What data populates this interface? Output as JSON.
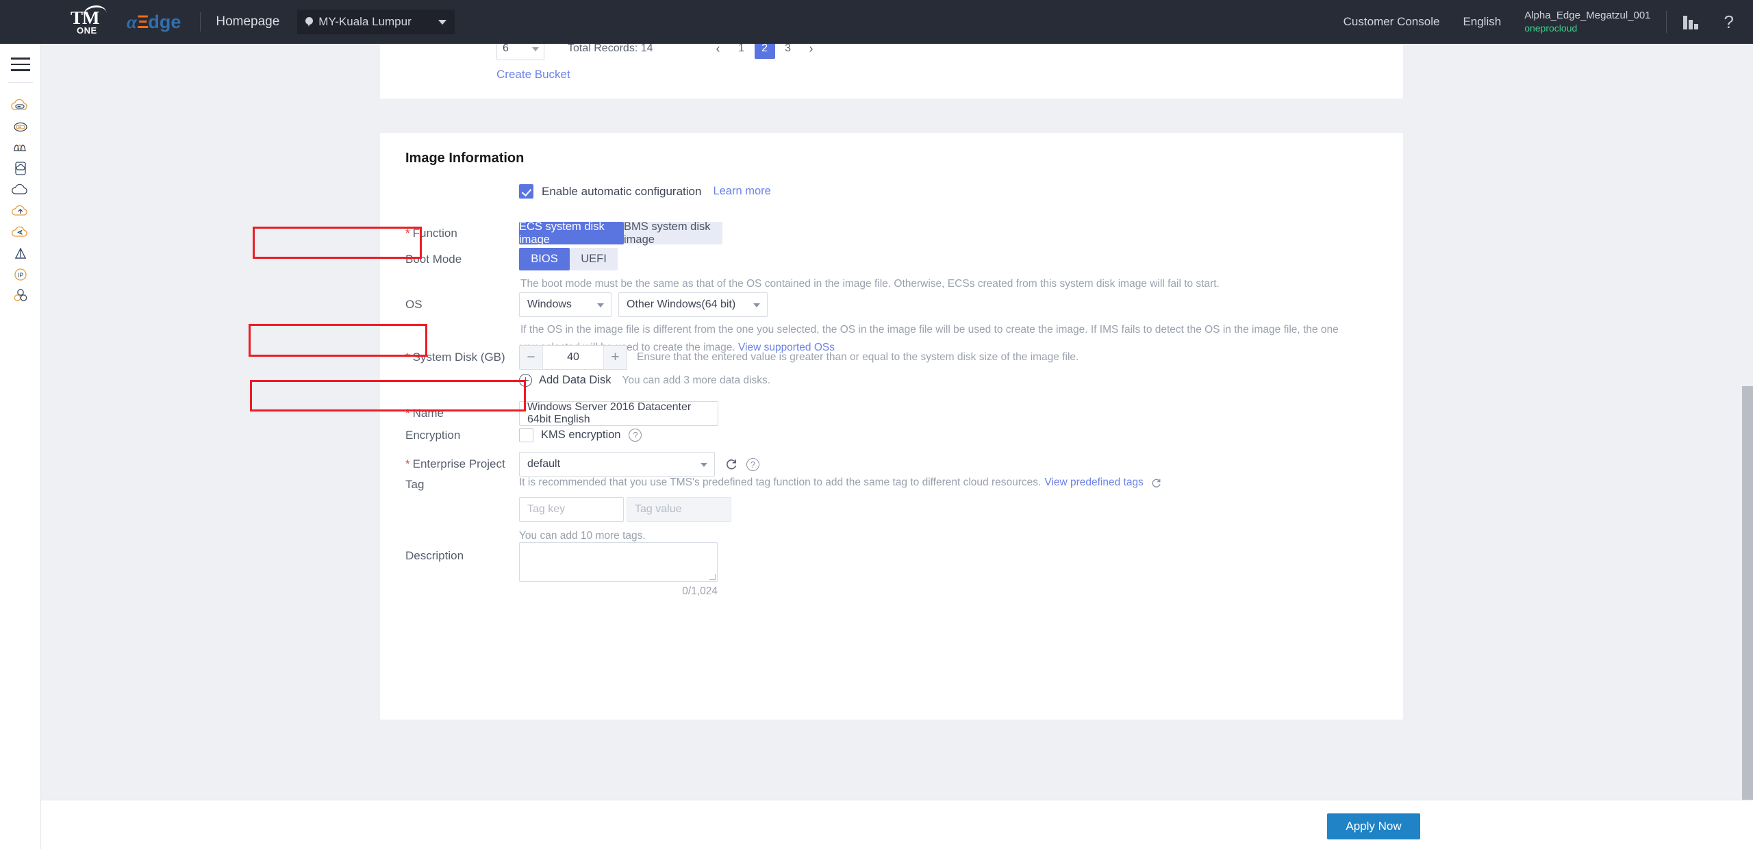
{
  "topnav": {
    "logo_tm": "TM",
    "logo_one": "ONE",
    "logo_alpha_a": "α",
    "logo_alpha_e": "Ξ",
    "logo_alpha_dge": "dge",
    "homepage": "Homepage",
    "region": "MY-Kuala Lumpur",
    "customer_console": "Customer Console",
    "language": "English",
    "account_name": "Alpha_Edge_Megatzul_001",
    "account_sub": "oneprocloud",
    "chart_icon": "bar-chart-icon",
    "help_icon": "question-mark-icon"
  },
  "rail": {
    "menu_icon": "hamburger-menu-icon",
    "items": [
      {
        "icon": "cloud-server-icon"
      },
      {
        "icon": "cloud-storage-icon"
      },
      {
        "icon": "network-wave-icon"
      },
      {
        "icon": "device-cloud-icon"
      },
      {
        "icon": "cloud-icon"
      },
      {
        "icon": "cloud-upload-icon"
      },
      {
        "icon": "cloud-migrate-icon"
      },
      {
        "icon": "antenna-icon"
      },
      {
        "icon": "ip-icon"
      },
      {
        "icon": "cluster-icon"
      }
    ]
  },
  "pager": {
    "page_size": "6",
    "total_records": "Total Records: 14",
    "prev": "‹",
    "next": "›",
    "pages": [
      "1",
      "2",
      "3"
    ],
    "active_page": "2"
  },
  "create_bucket": "Create Bucket",
  "form": {
    "section_title": "Image Information",
    "auto_config": {
      "label": "Enable automatic configuration",
      "learn_more": "Learn more",
      "checked": true
    },
    "function": {
      "label": "Function",
      "required": "*",
      "options": [
        "ECS system disk image",
        "BMS system disk image"
      ],
      "selected": "ECS system disk image"
    },
    "boot_mode": {
      "label": "Boot Mode",
      "options": [
        "BIOS",
        "UEFI"
      ],
      "selected": "BIOS",
      "hint": "The boot mode must be the same as that of the OS contained in the image file. Otherwise, ECSs created from this system disk image will fail to start."
    },
    "os": {
      "label": "OS",
      "family": "Windows",
      "version": "Other Windows(64 bit)",
      "hint": "If the OS in the image file is different from the one you selected, the OS in the image file will be used to create the image. If IMS fails to detect the OS in the image file, the one you selected will be used to create the image.",
      "hint_link": "View supported OSs"
    },
    "system_disk": {
      "label": "System Disk (GB)",
      "required": "*",
      "value": "40",
      "minus": "−",
      "plus": "+",
      "hint": "Ensure that the entered value is greater than or equal to the system disk size of the image file."
    },
    "add_data_disk": {
      "label": "Add Data Disk",
      "hint": "You can add 3 more data disks."
    },
    "name": {
      "label": "Name",
      "required": "*",
      "value": "Windows Server 2016 Datacenter 64bit English"
    },
    "encryption": {
      "label": "Encryption",
      "kms_label": "KMS encryption",
      "checked": false,
      "help_icon": "question-mark-icon"
    },
    "enterprise_project": {
      "label": "Enterprise Project",
      "required": "*",
      "value": "default",
      "refresh_icon": "refresh-icon",
      "help_icon": "question-mark-icon"
    },
    "tag": {
      "label": "Tag",
      "hint": "It is recommended that you use TMS's predefined tag function to add the same tag to different cloud resources.",
      "hint_link": "View predefined tags",
      "refresh_icon": "refresh-icon",
      "key_placeholder": "Tag key",
      "value_placeholder": "Tag value",
      "counter": "You can add 10 more tags."
    },
    "description": {
      "label": "Description",
      "value": "",
      "counter": "0/1,024"
    }
  },
  "footer": {
    "apply": "Apply Now"
  },
  "colors": {
    "accent_blue": "#5a74e0",
    "apply_blue": "#1f83c6",
    "annotation_red": "#ee1b24",
    "link": "#6c83e8",
    "required_red": "#e0403f",
    "account_green": "#3cd18c",
    "nav_dark": "#282c37"
  }
}
